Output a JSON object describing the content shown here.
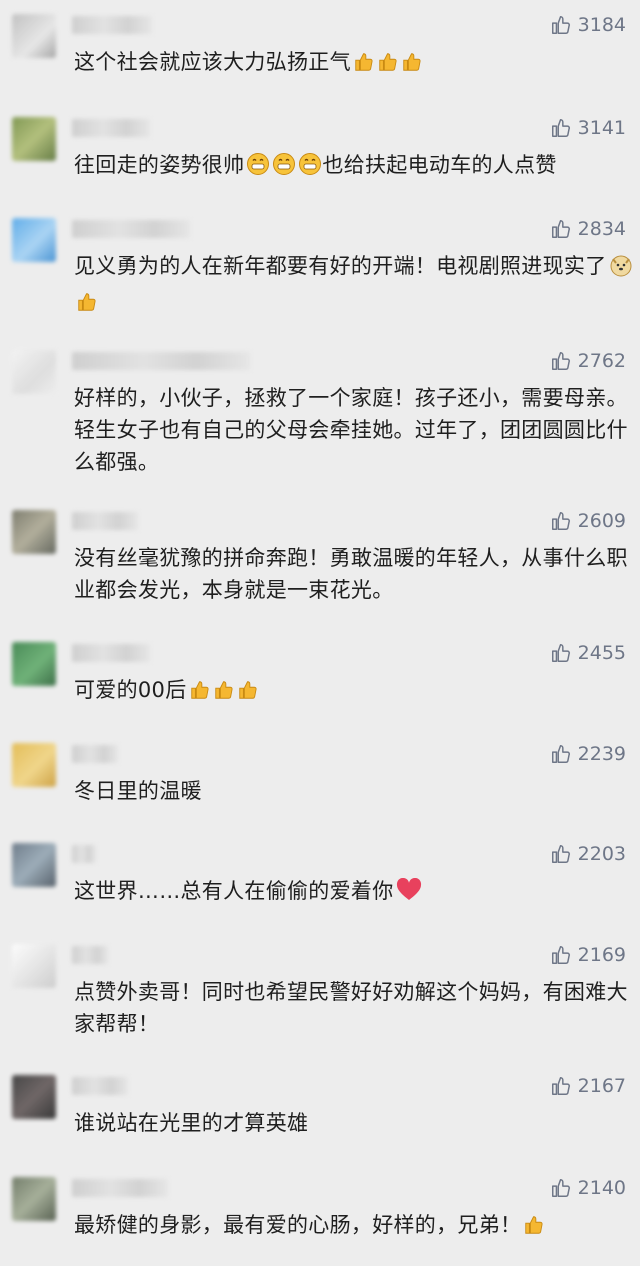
{
  "comments": [
    {
      "likes": "3184",
      "text": "这个社会就应该大力弘扬正气",
      "emojis": [
        "thumbs-up-emoji",
        "thumbs-up-emoji",
        "thumbs-up-emoji"
      ]
    },
    {
      "likes": "3141",
      "text_before": "往回走的姿势很帅",
      "text": "也给扶起电动车的人点赞",
      "emojis": [
        "grin-emoji",
        "grin-emoji",
        "grin-emoji"
      ]
    },
    {
      "likes": "2834",
      "text": "见义勇为的人在新年都要有好的开端！电视剧照进现实了",
      "emojis": [
        "doge-emoji",
        "thumbs-up-emoji"
      ]
    },
    {
      "likes": "2762",
      "text": "好样的，小伙子，拯救了一个家庭！孩子还小，需要母亲。轻生女子也有自己的父母会牵挂她。过年了，团团圆圆比什么都强。"
    },
    {
      "likes": "2609",
      "text": "没有丝毫犹豫的拼命奔跑！勇敢温暖的年轻人，从事什么职业都会发光，本身就是一束花光。"
    },
    {
      "likes": "2455",
      "text": "可爱的00后",
      "emojis": [
        "thumbs-up-emoji",
        "thumbs-up-emoji",
        "thumbs-up-emoji"
      ]
    },
    {
      "likes": "2239",
      "text": "冬日里的温暖"
    },
    {
      "likes": "2203",
      "text": "这世界……总有人在偷偷的爱着你",
      "emojis": [
        "heart-emoji"
      ]
    },
    {
      "likes": "2169",
      "text": "点赞外卖哥！同时也希望民警好好劝解这个妈妈，有困难大家帮帮！"
    },
    {
      "likes": "2167",
      "text": "谁说站在光里的才算英雄"
    },
    {
      "likes": "2140",
      "text": "最矫健的身影，最有爱的心肠，好样的，兄弟！",
      "emojis": [
        "thumbs-up-emoji"
      ]
    }
  ],
  "colors": {
    "background": "#ededed",
    "likes": "#6e7687",
    "text": "#1f1f1f"
  },
  "icons": {
    "like": "thumbs-up-outline-icon"
  }
}
